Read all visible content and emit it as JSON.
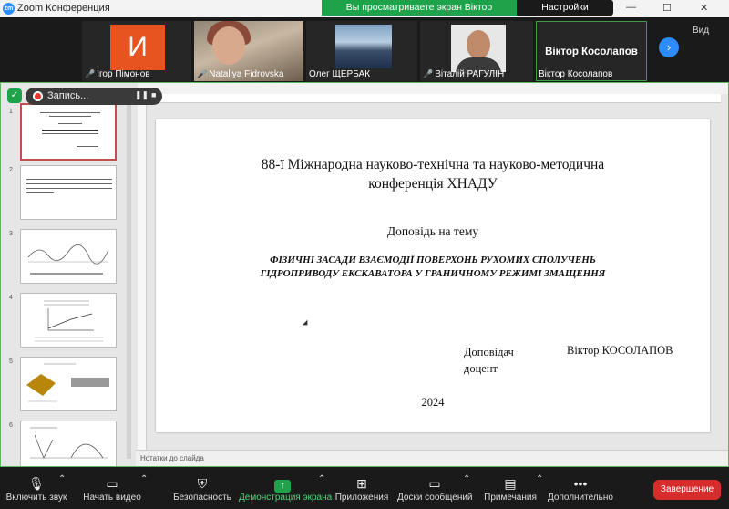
{
  "window": {
    "title": "Zoom Конференция"
  },
  "banner": {
    "sharing_text": "Вы просматриваете экран Віктор Косолапов",
    "view_options": "Настройки просмотра"
  },
  "participants": [
    {
      "name": "Ігор Пімонов",
      "initial": "И"
    },
    {
      "name": "Nataliya Fidrovska"
    },
    {
      "name": "Олег ЩЕРБАК"
    },
    {
      "name": "Віталій РАГУЛІН"
    },
    {
      "name": "Віктор Косолапов",
      "display_text": "Віктор Косолапов"
    }
  ],
  "strip": {
    "view_label": "Вид"
  },
  "recording": {
    "label": "Запись..."
  },
  "powerpoint": {
    "notes_placeholder": "Нотатки до слайда",
    "thumbnails": [
      {
        "num": "1"
      },
      {
        "num": "2"
      },
      {
        "num": "3"
      },
      {
        "num": "4"
      },
      {
        "num": "5"
      },
      {
        "num": "6"
      }
    ],
    "slide": {
      "conference_line1": "88-ї Міжнародна науково-технічна та науково-методична",
      "conference_line2": "конференція ХНАДУ",
      "topic_label": "Доповідь на тему",
      "title_line1": "ФІЗИЧНІ ЗАСАДИ ВЗАЄМОДІЇ ПОВЕРХОНЬ РУХОМИХ СПОЛУЧЕНЬ",
      "title_line2": "ГІДРОПРИВОДУ ЕКСКАВАТОРА У ГРАНИЧНОМУ РЕЖИМІ ЗМАЩЕННЯ",
      "speaker_role1": "Доповідач",
      "speaker_role2": "доцент",
      "speaker_name": "Віктор КОСОЛАПОВ",
      "year": "2024"
    }
  },
  "toolbar": {
    "mute": "Включить звук",
    "video": "Начать видео",
    "security": "Безопасность",
    "share": "Демонстрация экрана",
    "apps": "Приложения",
    "whiteboards": "Доски сообщений",
    "annotate": "Примечания",
    "more": "Дополнительно",
    "end": "Завершение"
  },
  "colors": {
    "accent": "#2d8cff",
    "share_green": "#1fa34a",
    "end_red": "#d72c2c",
    "avatar_orange": "#e8541f"
  }
}
